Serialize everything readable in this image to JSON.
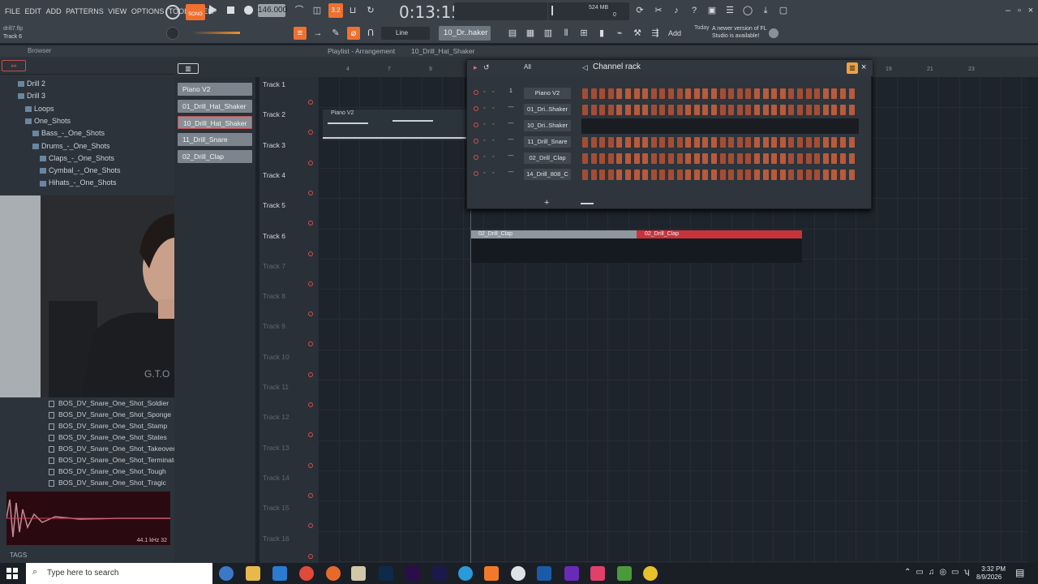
{
  "menu": [
    "FILE",
    "EDIT",
    "ADD",
    "PATTERNS",
    "VIEW",
    "OPTIONS",
    "TOOLS",
    "HELP"
  ],
  "project": {
    "file": "drill7.flp",
    "hint": "Track 6"
  },
  "transport": {
    "song_badge": "SONG",
    "tempo": "146.000",
    "time": "0:13:15",
    "mem": "524 MB",
    "mem_sub": "0",
    "steps_badge": "3.2"
  },
  "toolbar": {
    "snap": "Line",
    "pattern": "10_Dr..haker",
    "add": "Add",
    "news_title": "Today",
    "news_text": "A newer version of FL Studio is available!"
  },
  "browser": {
    "title": "Browser",
    "tree": [
      {
        "label": "Drill 2",
        "indent": 0
      },
      {
        "label": "Drill 3",
        "indent": 0
      },
      {
        "label": "Loops",
        "indent": 1
      },
      {
        "label": "One_Shots",
        "indent": 1
      },
      {
        "label": "Bass_-_One_Shots",
        "indent": 2
      },
      {
        "label": "Drums_-_One_Shots",
        "indent": 2
      },
      {
        "label": "Claps_-_One_Shots",
        "indent": 3
      },
      {
        "label": "Cymbal_-_One_Shots",
        "indent": 3
      },
      {
        "label": "Hihats_-_One_Shots",
        "indent": 3
      }
    ],
    "files": [
      "BOS_DV_Snare_One_Shot_Soldier",
      "BOS_DV_Snare_One_Shot_Sponge",
      "BOS_DV_Snare_One_Shot_Stamp",
      "BOS_DV_Snare_One_Shot_States",
      "BOS_DV_Snare_One_Shot_Takeover",
      "BOS_DV_Snare_One_Shot_Terminator",
      "BOS_DV_Snare_One_Shot_Tough",
      "BOS_DV_Snare_One_Shot_Tragic"
    ],
    "sample_rate": "44.1 kHz 32",
    "tags": "TAGS"
  },
  "playlist": {
    "title": "Playlist - Arrangement",
    "pattern": "10_Drill_Hat_Shaker",
    "picker": [
      "Piano V2",
      "01_Drill_Hat_Shaker",
      "10_Drill_Hat_Shaker",
      "11_Drill_Snare",
      "02_Drill_Clap"
    ],
    "tracks": [
      "Track 1",
      "Track 2",
      "Track 3",
      "Track 4",
      "Track 5",
      "Track 6",
      "Track 7",
      "Track 8",
      "Track 9",
      "Track 10",
      "Track 11",
      "Track 12",
      "Track 13",
      "Track 14",
      "Track 15",
      "Track 16"
    ],
    "bars": [
      "4",
      "7",
      "9",
      "19",
      "21",
      "23"
    ],
    "clips": {
      "piano": "Piano V2",
      "clap_a": "02_Drill_Clap",
      "clap_b": "02_Drill_Clap"
    }
  },
  "channel_rack": {
    "title": "Channel rack",
    "filter": "All",
    "channels": [
      {
        "num": "1",
        "name": "Piano V2"
      },
      {
        "num": "---",
        "name": "01_Dri..Shaker"
      },
      {
        "num": "---",
        "name": "10_Dri..Shaker"
      },
      {
        "num": "---",
        "name": "11_Drill_Snare"
      },
      {
        "num": "---",
        "name": "02_Drill_Clap"
      },
      {
        "num": "---",
        "name": "14_Drill_808_C"
      }
    ]
  },
  "taskbar": {
    "search_placeholder": "Type here to search",
    "time": "3:32 PM",
    "date": "8/9/2026"
  },
  "colors": {
    "accent": "#f07030",
    "step": "#a44d34",
    "clip_red": "#c8343c",
    "clip_grey": "#8f979e"
  }
}
